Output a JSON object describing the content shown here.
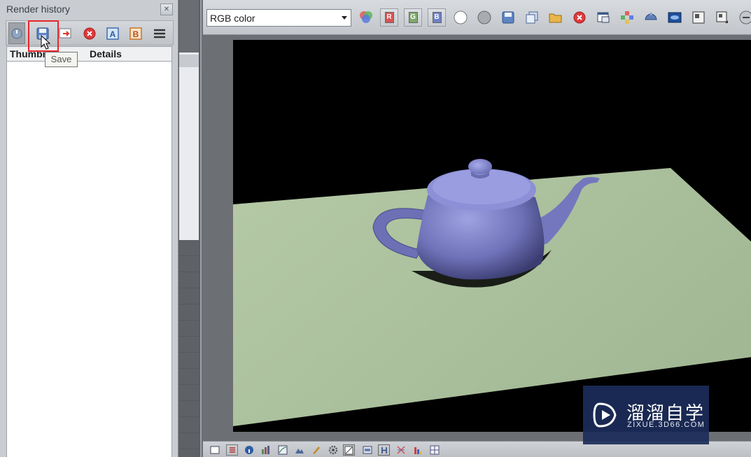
{
  "history_panel": {
    "title": "Render history",
    "columns": [
      "Thumbnail",
      "Details"
    ],
    "column_thumbnail_visible": "Thumbn",
    "tooltip": "Save"
  },
  "framebuffer": {
    "channel_select": "RGB color",
    "channel_buttons": [
      "R",
      "G",
      "B"
    ],
    "toolbar_icons": [
      "colors-icon",
      "red-channel",
      "green-channel",
      "blue-channel",
      "white-circle-icon",
      "gray-circle-icon",
      "save-icon",
      "copy-icon",
      "open-icon",
      "clear-icon",
      "window-icon",
      "tiles-icon",
      "render-icon",
      "region-icon",
      "panel-icon",
      "panel-arrow-icon",
      "more-icon"
    ]
  },
  "watermark": {
    "name": "溜溜自学",
    "domain": "ZIXUE.3D66.COM"
  },
  "colors": {
    "panel": "#c9cdd2",
    "viewport": "#000000",
    "floor": "#b3c9a4",
    "teapot": "#7a7dc4",
    "highlight": "#e8262c",
    "watermark_bg": "#1c2c5a"
  }
}
